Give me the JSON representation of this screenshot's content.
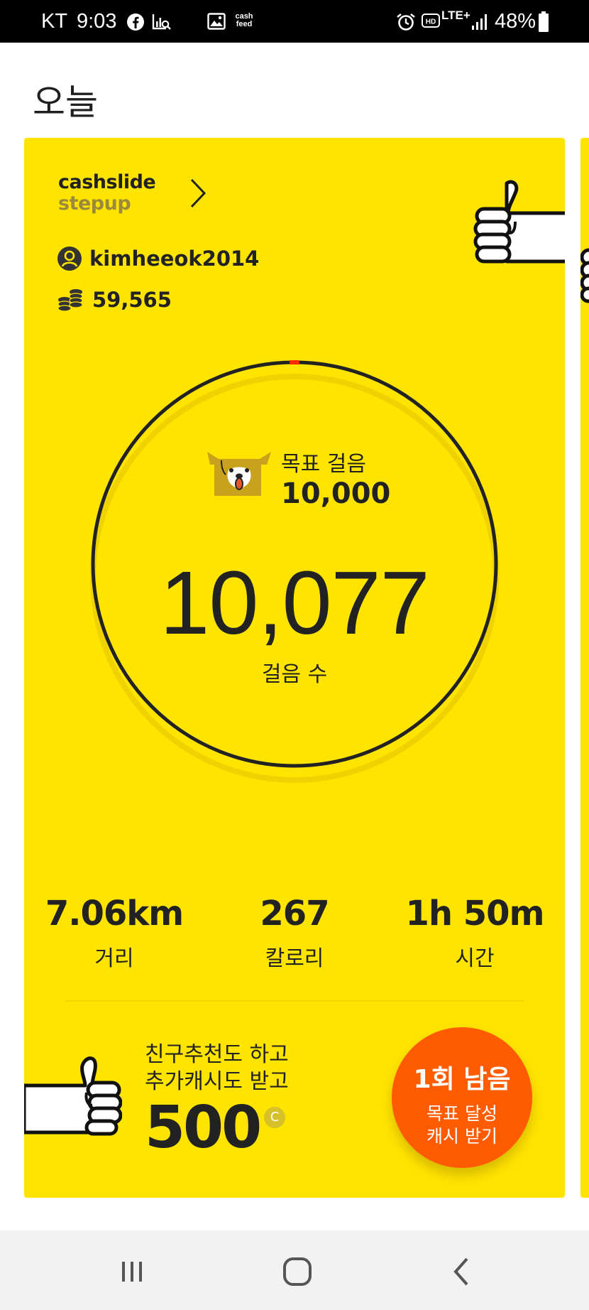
{
  "status_bar": {
    "carrier": "KT",
    "time": "9:03",
    "network": "LTE+",
    "battery": "48%",
    "icons": [
      "facebook-icon",
      "stats-icon",
      "image-icon",
      "cashfeed-icon",
      "alarm-icon",
      "hd-icon",
      "signal-icon",
      "battery-icon"
    ],
    "cashfeed_line1": "cash",
    "cashfeed_line2": "feed"
  },
  "header": {
    "title": "오늘"
  },
  "card": {
    "logo_line1": "cashslide",
    "logo_line2": "stepup",
    "username": "kimheeok2014",
    "balance": "59,565",
    "goal_label": "목표 걸음",
    "goal_value": "10,000",
    "steps": "10,077",
    "steps_label": "걸음 수",
    "progress_fraction": 1.0077,
    "stats": [
      {
        "value": "7.06km",
        "label": "거리"
      },
      {
        "value": "267",
        "label": "칼로리"
      },
      {
        "value": "1h 50m",
        "label": "시간"
      }
    ],
    "promo_line1": "친구추천도 하고",
    "promo_line2": "추가캐시도 받고",
    "promo_amount": "500",
    "promo_currency": "C",
    "cta_line1": "1회 남음",
    "cta_line2": "목표 달성",
    "cta_line3": "캐시 받기"
  },
  "colors": {
    "card": "#ffe400",
    "cta": "#ff5b00",
    "ring": "#222222",
    "ring_marker": "#ff2a00"
  },
  "nav": {
    "icons": [
      "recent-apps-icon",
      "home-icon",
      "back-icon"
    ]
  }
}
